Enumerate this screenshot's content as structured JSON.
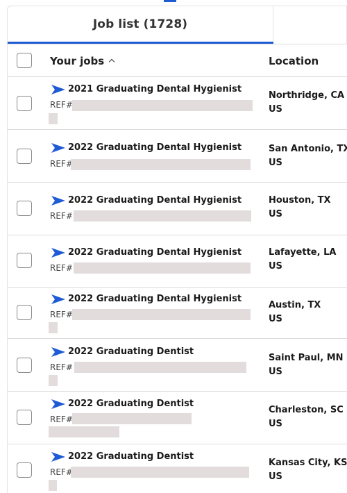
{
  "tab": {
    "label": "Job list (1728)"
  },
  "table": {
    "columns": {
      "jobs": "Your jobs",
      "location": "Location"
    },
    "rows": [
      {
        "title": "2021 Graduating Dental Hygienist",
        "ref": "REF#",
        "city": "Northridge, CA",
        "country": "US"
      },
      {
        "title": "2022 Graduating Dental Hygienist",
        "ref": "REF#",
        "city": "San Antonio, TX",
        "country": "US"
      },
      {
        "title": "2022 Graduating Dental Hygienist",
        "ref": "REF#",
        "city": "Houston, TX",
        "country": "US"
      },
      {
        "title": "2022 Graduating Dental Hygienist",
        "ref": "REF#",
        "city": "Lafayette, LA",
        "country": "US"
      },
      {
        "title": "2022 Graduating Dental Hygienist",
        "ref": "REF#",
        "city": "Austin, TX",
        "country": "US"
      },
      {
        "title": "2022 Graduating Dentist",
        "ref": "REF#",
        "city": "Saint Paul, MN",
        "country": "US"
      },
      {
        "title": "2022 Graduating Dentist",
        "ref": "REF#",
        "city": "Charleston, SC",
        "country": "US"
      },
      {
        "title": "2022 Graduating Dentist",
        "ref": "REF#",
        "city": "Kansas City, KS",
        "country": "US"
      }
    ]
  },
  "colors": {
    "accent": "#1e5bd4",
    "redaction": "#e2dcdc",
    "divider": "#dcdcdc"
  },
  "icons": {
    "row_marker": "paper-plane-icon",
    "sort": "chevron-up-icon"
  }
}
